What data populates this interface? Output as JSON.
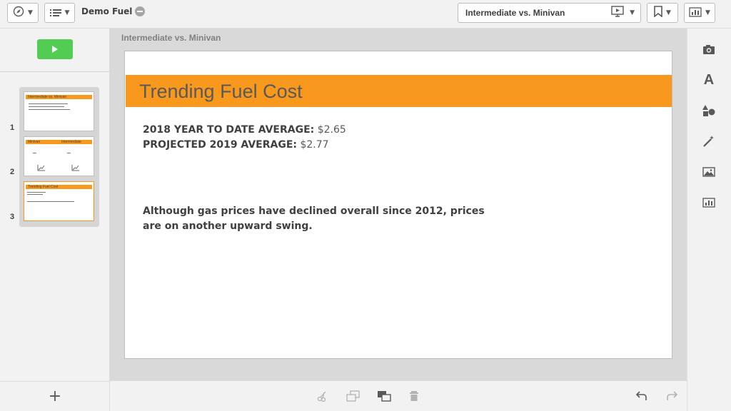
{
  "header": {
    "app_title": "Demo Fuel",
    "story_name": "Intermediate vs. Minivan"
  },
  "icons": {
    "navigation": "compass-icon",
    "menu": "list-icon",
    "published": "globe-icon",
    "presentation": "present-screen-icon",
    "bookmarks": "bookmark-icon",
    "charts": "bar-chart-icon",
    "snapshot": "camera-icon",
    "text": "text-icon",
    "shapes": "shapes-icon",
    "effects": "magic-wand-icon",
    "media": "image-icon",
    "objects": "object-chart-icon",
    "cut": "scissors-icon",
    "duplicate": "duplicate-icon",
    "layer": "layer-icon",
    "delete": "trash-icon",
    "undo": "undo-icon",
    "redo": "redo-icon"
  },
  "left_panel": {
    "add_label": "+",
    "thumbnails": [
      {
        "number": "1",
        "title": "Intermediate vs. Minivan"
      },
      {
        "number": "2",
        "left_title": "Minivan",
        "right_title": "Intermediate"
      },
      {
        "number": "3",
        "title": "Trending Fuel Cost"
      }
    ]
  },
  "canvas": {
    "slide_label": "Intermediate vs. Minivan"
  },
  "slide": {
    "title": "Trending Fuel Cost",
    "stat1_label": "2018 YEAR TO DATE AVERAGE:",
    "stat1_value": "$2.65",
    "stat2_label": "PROJECTED 2019 AVERAGE:",
    "stat2_value": "$2.77",
    "note": "Although gas prices have declined overall since 2012, prices are on another upward swing."
  },
  "colors": {
    "accent": "#f8981d",
    "play": "#52cc52"
  }
}
